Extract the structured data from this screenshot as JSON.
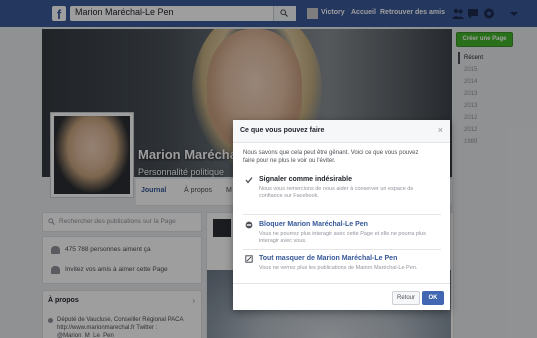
{
  "topbar": {
    "search_value": "Marion Maréchal-Le Pen",
    "nav": [
      "Victory",
      "Accueil",
      "Retrouver des amis"
    ]
  },
  "header": {
    "name": "Marion Maréchal",
    "category": "Personnalité politique",
    "create_page": "Créer une Page"
  },
  "tabs": [
    "Journal",
    "À propos",
    "M"
  ],
  "years": [
    "Récent",
    "2015",
    "2014",
    "2013",
    "2013",
    "2012",
    "2012",
    "1989"
  ],
  "left": {
    "search_placeholder": "Rechercher des publications sur la Page",
    "stats": [
      "475 788 personnes aiment ça",
      "Invitez vos amis à aimer cette Page"
    ],
    "about_title": "À propos",
    "about_text": "Député de Vaucluse, Conseiller Régional PACA http://www.marionmarechal.fr Twitter : @Marion_M_Le_Pen"
  },
  "dialog": {
    "title": "Ce que vous pouvez faire",
    "close": "×",
    "intro": "Nous savons que cela peut être gênant. Voici ce que vous pouvez faire pour ne plus le voir ou l'éviter.",
    "options": [
      {
        "title": "Signaler comme indésirable",
        "desc": "Nous vous remercions de nous aider à conserver un espace de confiance sur Facebook."
      },
      {
        "title": "Bloquer Marion Maréchal-Le Pen",
        "desc": "Vous ne pourrez plus interagir avec cette Page et elle ne pourra plus interagir avec vous."
      },
      {
        "title": "Tout masquer de Marion Maréchal-Le Pen",
        "desc": "Vous ne verrez plus les publications de Marion Maréchal-Le Pen."
      }
    ],
    "cancel": "Retour",
    "ok": "OK"
  }
}
